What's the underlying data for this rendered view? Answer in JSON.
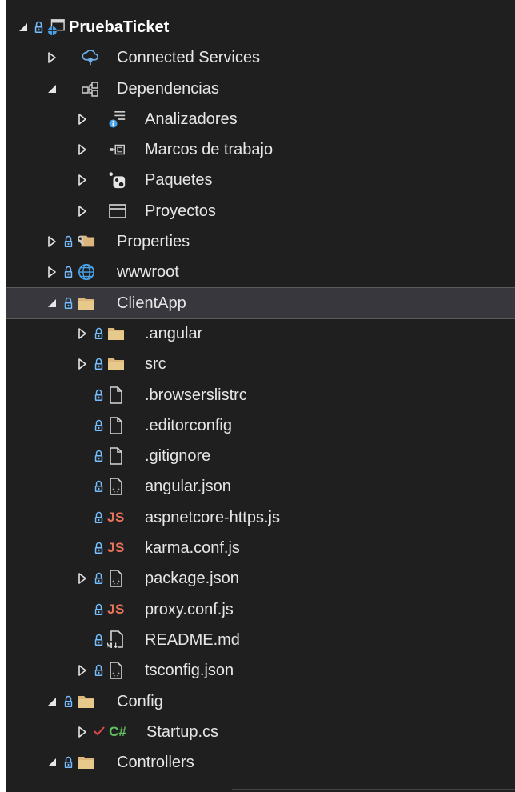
{
  "solution_explorer": {
    "items": [
      {
        "label": "PruebaTicket",
        "icon": "web-project-icon",
        "level": 0,
        "expanded": true,
        "locked": true
      },
      {
        "label": "Connected Services",
        "icon": "connected-services-icon",
        "level": 1,
        "expanded": false,
        "locked": false
      },
      {
        "label": "Dependencias",
        "icon": "dependencies-icon",
        "level": 1,
        "expanded": true,
        "locked": false
      },
      {
        "label": "Analizadores",
        "icon": "analyzers-icon",
        "level": 2,
        "expanded": false,
        "locked": false
      },
      {
        "label": "Marcos de trabajo",
        "icon": "frameworks-icon",
        "level": 2,
        "expanded": false,
        "locked": false
      },
      {
        "label": "Paquetes",
        "icon": "packages-icon",
        "level": 2,
        "expanded": false,
        "locked": false
      },
      {
        "label": "Proyectos",
        "icon": "projects-icon",
        "level": 2,
        "expanded": false,
        "locked": false
      },
      {
        "label": "Properties",
        "icon": "properties-folder-icon",
        "level": 1,
        "expanded": false,
        "locked": true
      },
      {
        "label": "wwwroot",
        "icon": "globe-icon",
        "level": 1,
        "expanded": false,
        "locked": true
      },
      {
        "label": "ClientApp",
        "icon": "folder-icon",
        "level": 1,
        "expanded": true,
        "locked": true,
        "selected": true
      },
      {
        "label": ".angular",
        "icon": "folder-icon",
        "level": 2,
        "expanded": false,
        "locked": true
      },
      {
        "label": "src",
        "icon": "folder-icon",
        "level": 2,
        "expanded": false,
        "locked": true
      },
      {
        "label": ".browserslistrc",
        "icon": "file-icon",
        "level": 2,
        "locked": true
      },
      {
        "label": ".editorconfig",
        "icon": "file-icon",
        "level": 2,
        "locked": true
      },
      {
        "label": ".gitignore",
        "icon": "file-icon",
        "level": 2,
        "locked": true
      },
      {
        "label": "angular.json",
        "icon": "json-file-icon",
        "level": 2,
        "locked": true
      },
      {
        "label": "aspnetcore-https.js",
        "icon": "js-file-icon",
        "level": 2,
        "locked": true
      },
      {
        "label": "karma.conf.js",
        "icon": "js-file-icon",
        "level": 2,
        "locked": true
      },
      {
        "label": "package.json",
        "icon": "json-file-icon",
        "level": 2,
        "expanded": false,
        "locked": true
      },
      {
        "label": "proxy.conf.js",
        "icon": "js-file-icon",
        "level": 2,
        "locked": true
      },
      {
        "label": "README.md",
        "icon": "markdown-file-icon",
        "level": 2,
        "locked": true
      },
      {
        "label": "tsconfig.json",
        "icon": "json-file-icon",
        "level": 2,
        "expanded": false,
        "locked": true
      },
      {
        "label": "Config",
        "icon": "folder-icon",
        "level": 1,
        "expanded": true,
        "locked": true
      },
      {
        "label": "Startup.cs",
        "icon": "csharp-file-icon",
        "level": 2,
        "expanded": false,
        "locked": false,
        "checked": true
      },
      {
        "label": "Controllers",
        "icon": "folder-icon",
        "level": 1,
        "expanded": true,
        "locked": true
      }
    ],
    "glyphs": {
      "js": "JS",
      "cs": "C#",
      "md": "M↓"
    },
    "colors": {
      "background": "#1f1f1f",
      "selected_row": "#37373d",
      "folder": "#dcb67a",
      "lock": "#75beff",
      "js": "#e8735b",
      "csharp": "#60c060",
      "check": "#e04848"
    }
  }
}
